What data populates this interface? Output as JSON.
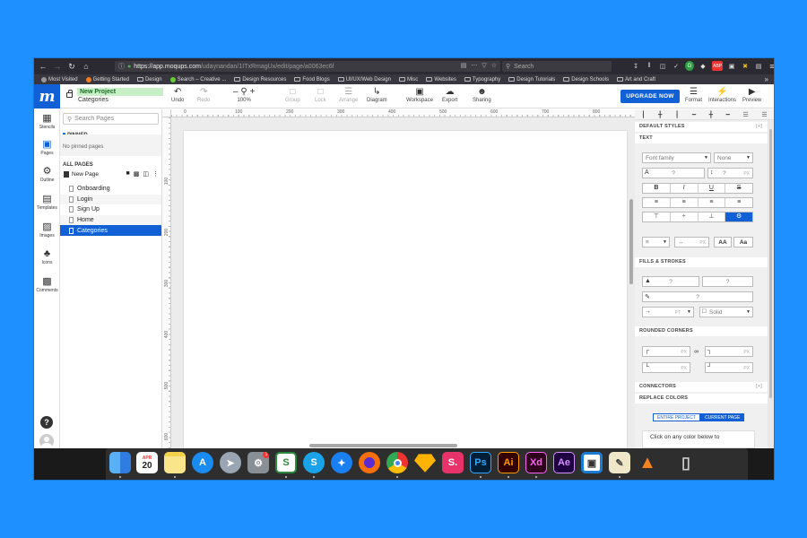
{
  "browser": {
    "url_host": "https://app.moqups.com",
    "url_rest": "/udaynandan/1ITxRmagUx/edit/page/a0063ec6f",
    "search_placeholder": "Search",
    "bookmarks": [
      "Most Visited",
      "Getting Started",
      "Design",
      "Search – Creative ...",
      "Design Resources",
      "Food Blogs",
      "UI/UX/Web Design",
      "Misc",
      "Websites",
      "Typography",
      "Design Tutorials",
      "Design Schools",
      "Art and Craft"
    ],
    "extension_badge": "ABP"
  },
  "toolbar": {
    "project_name": "New Project",
    "current_page": "Categories",
    "undo": "Undo",
    "redo": "Redo",
    "zoom": "100%",
    "group": "Group",
    "lock": "Lock",
    "arrange": "Arrange",
    "diagram": "Diagram",
    "workspace": "Workspace",
    "export": "Export",
    "sharing": "Sharing",
    "upgrade": "UPGRADE NOW",
    "format": "Format",
    "interactions": "Interactions",
    "preview": "Preview"
  },
  "rail": {
    "stencils": "Stencils",
    "pages": "Pages",
    "outline": "Outline",
    "templates": "Templates",
    "images": "Images",
    "icons": "Icons",
    "comments": "Comments"
  },
  "pages_panel": {
    "search_placeholder": "Search Pages",
    "pinned_label": "PINNED",
    "no_pinned": "No pinned pages",
    "all_pages_label": "ALL PAGES",
    "new_page": "New Page",
    "pages": [
      "Onboarding",
      "Login",
      "Sign Up",
      "Home",
      "Categories"
    ],
    "selected_page": "Categories"
  },
  "rulers": {
    "top": [
      "0",
      "100",
      "200",
      "300",
      "400",
      "500",
      "600",
      "700",
      "800"
    ],
    "left": [
      "100",
      "200",
      "300",
      "400",
      "500",
      "600"
    ]
  },
  "properties": {
    "default_styles": "DEFAULT STYLES",
    "text": "TEXT",
    "font_family": "Font family",
    "font_weight": "None",
    "placeholder_q": "?",
    "unit_px": "PX",
    "bold": "B",
    "italic": "I",
    "underline": "U",
    "strike": "S",
    "aa_upper": "AA",
    "aa_mixed": "Aa",
    "fills_strokes": "FILLS & STROKES",
    "stroke_style": "Solid",
    "unit_pt": "PT",
    "rounded_corners": "ROUNDED CORNERS",
    "connectors": "CONNECTORS",
    "replace_colors": "REPLACE COLORS",
    "entire_project": "ENTIRE PROJECT",
    "current_page": "CURRENT PAGE",
    "color_hint": "Click on any color below to",
    "plus": "[+]"
  },
  "dock": {
    "calendar_month": "APR",
    "calendar_day": "20",
    "sysprefs_badge": "1",
    "apps": [
      "Finder",
      "Calendar",
      "Notes",
      "App Store",
      "Launchpad",
      "System Preferences",
      "Slides",
      "Skype",
      "Safari",
      "Firefox",
      "Chrome",
      "Sketch",
      "Slides App",
      "Photoshop",
      "Illustrator",
      "Adobe XD",
      "After Effects",
      "Screen Recorder",
      "Preview",
      "VLC",
      "Trash"
    ],
    "labels": [
      "Ps",
      "Ai",
      "Xd",
      "Ae",
      "S",
      "S.",
      "S"
    ]
  },
  "colors": {
    "background": "#1e90ff",
    "accent": "#1160d6",
    "project_badge_bg": "#c8f0c8"
  }
}
